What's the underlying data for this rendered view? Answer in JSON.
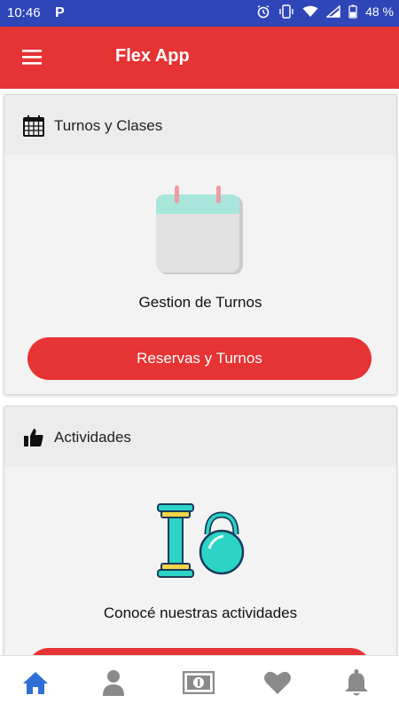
{
  "status_bar": {
    "time": "10:46",
    "notification_badge": "P",
    "battery_percent": "48 %",
    "icons": [
      "alarm-icon",
      "vibrate-icon",
      "wifi-icon",
      "signal-icon",
      "battery-icon"
    ]
  },
  "app_bar": {
    "title": "Flex App",
    "menu_icon": "hamburger-menu-icon"
  },
  "cards": [
    {
      "header_title": "Turnos y Clases",
      "header_icon": "calendar-icon",
      "illustration": "calendar-illustration",
      "caption": "Gestion de Turnos",
      "button_label": "Reservas y Turnos"
    },
    {
      "header_title": "Actividades",
      "header_icon": "thumbs-up-icon",
      "illustration": "dumbbell-kettlebell-illustration",
      "caption": "Conocé nuestras actividades",
      "button_label": ""
    }
  ],
  "bottom_nav": {
    "items": [
      "home-icon",
      "profile-icon",
      "money-icon",
      "favorites-icon",
      "notifications-icon"
    ],
    "active_index": 0
  },
  "colors": {
    "status_bar": "#2f46b8",
    "primary": "#e63333",
    "active_nav": "#2f6fd6",
    "inactive_nav": "#8a8a8a",
    "card_bg": "#f3f3f3",
    "card_header_bg": "#ececec"
  }
}
